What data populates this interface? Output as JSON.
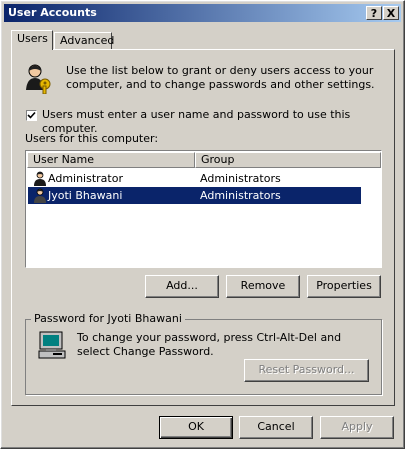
{
  "window": {
    "title": "User Accounts",
    "help_button": "?",
    "close_button": "X"
  },
  "tabs": [
    {
      "label": "Users"
    },
    {
      "label": "Advanced"
    }
  ],
  "intro": {
    "text": "Use the list below to grant or deny users access to your computer, and to change passwords and other settings."
  },
  "require_login": {
    "label": "Users must enter a user name and password to use this computer.",
    "checked": true
  },
  "users_list": {
    "label": "Users for this computer:",
    "columns": [
      "User Name",
      "Group"
    ],
    "rows": [
      {
        "user_name": "Administrator",
        "group": "Administrators",
        "selected": false
      },
      {
        "user_name": "Jyoti Bhawani",
        "group": "Administrators",
        "selected": true
      }
    ]
  },
  "list_buttons": {
    "add": "Add...",
    "remove": "Remove",
    "properties": "Properties"
  },
  "password_group": {
    "label": "Password for Jyoti Bhawani",
    "text": "To change your password, press Ctrl-Alt-Del and select Change Password.",
    "reset_button": "Reset Password..."
  },
  "dialog_buttons": {
    "ok": "OK",
    "cancel": "Cancel",
    "apply": "Apply"
  },
  "colors": {
    "title_start": "#0a246a",
    "title_end": "#a6caf0",
    "selection": "#0a246a",
    "face": "#d4d0c8"
  }
}
